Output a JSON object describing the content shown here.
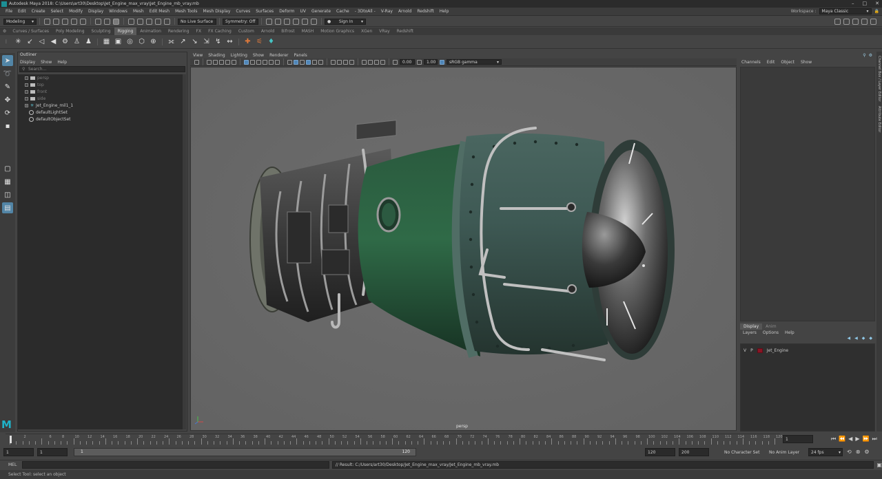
{
  "title_bar": {
    "title": "Autodesk Maya 2018: C:\\Users\\art30\\Desktop\\Jet_Engine_max_vray\\Jet_Engine_mb_vray.mb"
  },
  "menu_bar": {
    "items": [
      "File",
      "Edit",
      "Create",
      "Select",
      "Modify",
      "Display",
      "Windows",
      "Mesh",
      "Edit Mesh",
      "Mesh Tools",
      "Mesh Display",
      "Curves",
      "Surfaces",
      "Deform",
      "UV",
      "Generate",
      "Cache",
      "- 3DtoAll -",
      "V-Ray",
      "Arnold",
      "Redshift",
      "Help"
    ],
    "workspace_label": "Workspace :",
    "workspace_value": "Maya Classic"
  },
  "status_line": {
    "menu_set": "Modeling",
    "live_surface": "No Live Surface",
    "symmetry": "Symmetry: Off",
    "sign_in": "Sign In"
  },
  "shelf_tabs": [
    "Curves / Surfaces",
    "Poly Modeling",
    "Sculpting",
    "Rigging",
    "Animation",
    "Rendering",
    "FX",
    "FX Caching",
    "Custom",
    "Arnold",
    "Bifrost",
    "MASH",
    "Motion Graphics",
    "XGen",
    "VRay",
    "Redshift"
  ],
  "active_shelf_tab": "Rigging",
  "outliner": {
    "title": "Outliner",
    "menu": [
      "Display",
      "Show",
      "Help"
    ],
    "search_placeholder": "Search...",
    "items": [
      {
        "label": "persp",
        "kind": "camera",
        "dim": true
      },
      {
        "label": "top",
        "kind": "camera",
        "dim": true
      },
      {
        "label": "front",
        "kind": "camera",
        "dim": true
      },
      {
        "label": "side",
        "kind": "camera",
        "dim": true
      },
      {
        "label": "Jet_Engine_mil1_1",
        "kind": "group",
        "dim": false
      },
      {
        "label": "defaultLightSet",
        "kind": "set",
        "dim": false
      },
      {
        "label": "defaultObjectSet",
        "kind": "set",
        "dim": false
      }
    ]
  },
  "viewport": {
    "menu": [
      "View",
      "Shading",
      "Lighting",
      "Show",
      "Renderer",
      "Panels"
    ],
    "exposure": "0.00",
    "gamma": "1.00",
    "color_space": "sRGB gamma",
    "camera_label": "persp"
  },
  "channel_box": {
    "menu": [
      "Channels",
      "Edit",
      "Object",
      "Show"
    ],
    "side_tabs": [
      "Channel Box / Layer Editor",
      "Attribute Editor"
    ]
  },
  "layer_editor": {
    "tabs": [
      "Display",
      "Anim"
    ],
    "active_tab": "Display",
    "menu": [
      "Layers",
      "Options",
      "Help"
    ],
    "layers": [
      {
        "v": "V",
        "p": "P",
        "name": "Jet_Engine",
        "color": "#8b1424"
      }
    ]
  },
  "time_slider": {
    "start": 0,
    "end": 120,
    "tick_step": 5,
    "label_step": 5,
    "labels": [
      "2",
      "6",
      "8",
      "10",
      "12",
      "14",
      "16",
      "18",
      "20",
      "22",
      "24",
      "26",
      "28",
      "30",
      "32",
      "34",
      "36",
      "38",
      "40",
      "42",
      "44",
      "46",
      "48",
      "50",
      "52",
      "54",
      "56",
      "58",
      "60",
      "62",
      "64",
      "66",
      "68",
      "70",
      "72",
      "74",
      "76",
      "78",
      "80",
      "82",
      "84",
      "86",
      "88",
      "90",
      "92",
      "94",
      "96",
      "98",
      "100",
      "102",
      "104",
      "106",
      "108",
      "110",
      "112",
      "114",
      "116",
      "118",
      "120"
    ],
    "current_frame": "1"
  },
  "range_slider": {
    "start_field": "1",
    "playback_start": "1",
    "range_start_label": "1",
    "range_end_label": "120",
    "playback_end": "120",
    "end_field": "200",
    "character_set": "No Character Set",
    "anim_layer": "No Anim Layer",
    "fps": "24 fps"
  },
  "command_line": {
    "mode": "MEL",
    "result": "// Result: C:/Users/art30/Desktop/Jet_Engine_max_vray/Jet_Engine_mb_vray.mb"
  },
  "help_line": {
    "text": "Select Tool: select an object"
  },
  "colors": {
    "accent": "#5285a6",
    "engine_green": "#2f5a43",
    "layer_red": "#8b1424",
    "maya_teal": "#1c8f95"
  }
}
